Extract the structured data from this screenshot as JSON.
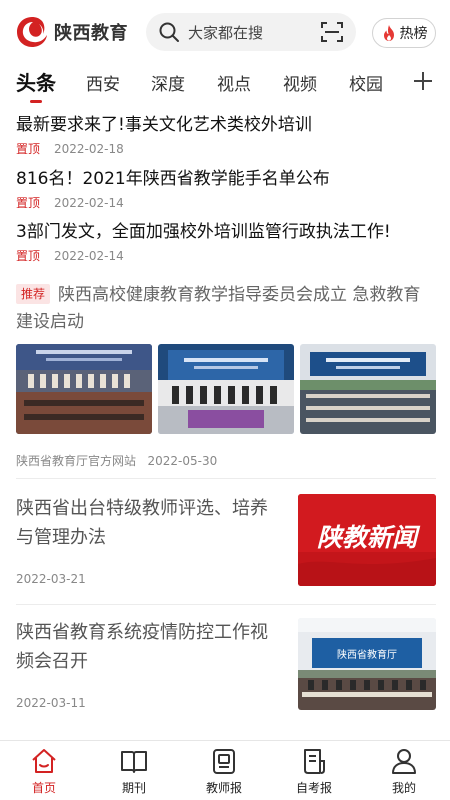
{
  "header": {
    "app_name": "陕西教育",
    "search_placeholder": "大家都在搜",
    "hot_label": "热榜"
  },
  "tabs": [
    {
      "label": "头条",
      "active": true
    },
    {
      "label": "西安"
    },
    {
      "label": "深度"
    },
    {
      "label": "视点"
    },
    {
      "label": "视频"
    },
    {
      "label": "校园"
    }
  ],
  "top_news": [
    {
      "title": "最新要求来了!事关文化艺术类校外培训",
      "tag": "置顶",
      "date": "2022-02-18"
    },
    {
      "title": "816名！2021年陕西省教学能手名单公布",
      "tag": "置顶",
      "date": "2022-02-14"
    },
    {
      "title": "3部门发文，全面加强校外培训监管行政执法工作!",
      "tag": "置顶",
      "date": "2022-02-14"
    }
  ],
  "recommended": {
    "badge": "推荐",
    "title": "陕西高校健康教育教学指导委员会成立 急救教育建设启动",
    "source": "陕西省教育厅官方网站",
    "date": "2022-05-30"
  },
  "news": [
    {
      "title": "陕西省出台特级教师评选、培养与管理办法",
      "date": "2022-03-21",
      "thumb_text": "陕教新闻"
    },
    {
      "title": "陕西省教育系统疫情防控工作视频会召开",
      "date": "2022-03-11",
      "thumb_text": "陕西省教育厅"
    }
  ],
  "bottom_nav": [
    {
      "label": "首页",
      "icon": "home-icon",
      "active": true
    },
    {
      "label": "期刊",
      "icon": "book-icon"
    },
    {
      "label": "教师报",
      "icon": "newspaper-icon"
    },
    {
      "label": "自考报",
      "icon": "exam-paper-icon"
    },
    {
      "label": "我的",
      "icon": "user-icon"
    }
  ],
  "colors": {
    "accent": "#d32222",
    "text": "#222222",
    "muted": "#888888"
  }
}
